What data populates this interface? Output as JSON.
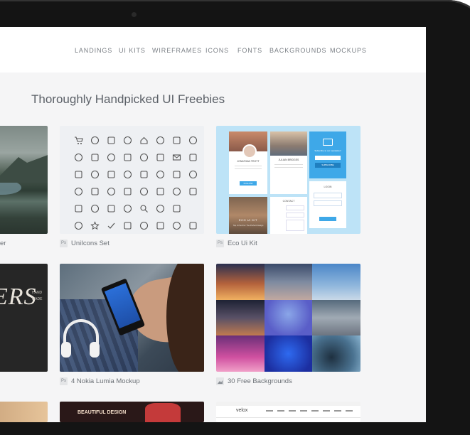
{
  "nav": {
    "items": [
      "LANDINGS",
      "UI KITS",
      "WIREFRAMES",
      "ICONS",
      "FONTS",
      "BACKGROUNDS",
      "MOCKUPS"
    ]
  },
  "heading": "Thoroughly Handpicked UI Freebies",
  "cards": [
    {
      "caption": "er"
    },
    {
      "caption": "UniIcons Set",
      "badge": "Ps"
    },
    {
      "caption": "Eco Ui Kit",
      "badge": "Ps"
    },
    {
      "caption": "4 Nokia Lumia Mockup",
      "badge": "Ps"
    },
    {
      "caption": "30 Free Backgrounds",
      "badge": "img"
    }
  ],
  "font_card": {
    "letters": "ERS",
    "side_top": "HAND",
    "side_bottom": "MADE"
  },
  "eco_kit": {
    "profile1": "JONATHAN TROTT",
    "profile2": "JULIAN BRIDGES",
    "newsletter": "Subscribe to our newsletter!",
    "subscribe": "SUBSCRIBE",
    "follow": "FOLLOW",
    "login": "LOGIN",
    "contact": "CONTACT",
    "card_title": "ECO UI KIT",
    "card_sub": "Top Ui Set For The Perfect Design"
  },
  "bottom_peek": {
    "text1": "BEAUTIFUL DESIGN",
    "logo": "velox"
  },
  "colors": {
    "accent": "#3ea8e8",
    "nav_text": "#7a7f85",
    "bg": "#f5f5f6"
  }
}
